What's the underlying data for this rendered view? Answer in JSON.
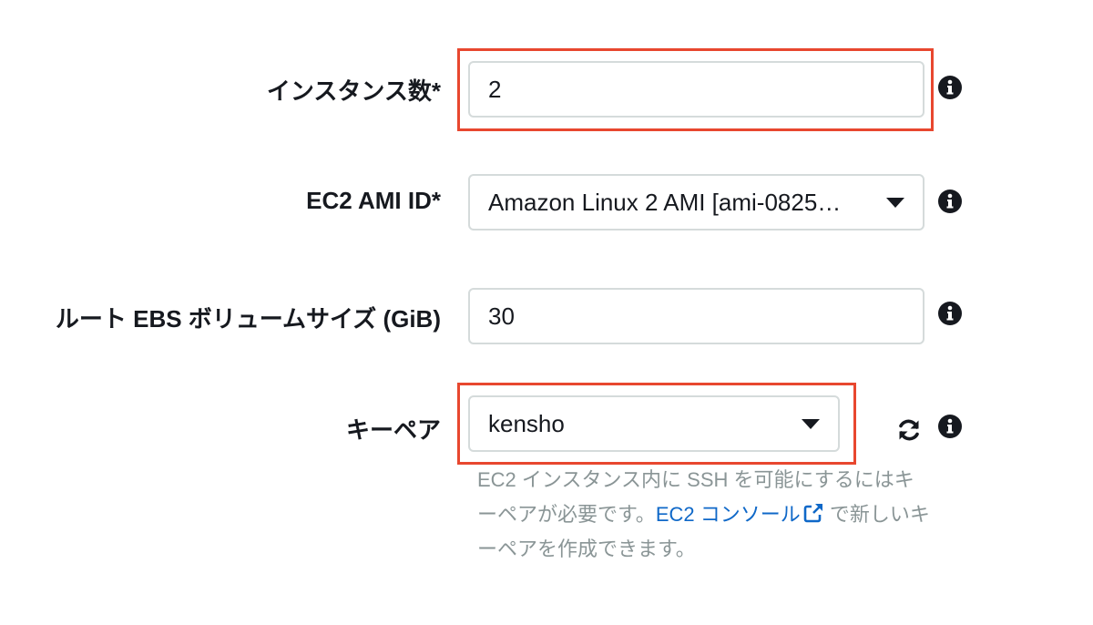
{
  "fields": {
    "instance_count": {
      "label": "インスタンス数*",
      "value": "2",
      "highlighted": true
    },
    "ami_id": {
      "label": "EC2 AMI ID*",
      "value": "Amazon Linux 2 AMI [ami-0825…",
      "icon": "chevron-down-icon"
    },
    "root_ebs_size": {
      "label": "ルート EBS ボリュームサイズ (GiB)",
      "value": "30"
    },
    "key_pair": {
      "label": "キーペア",
      "value": "kensho",
      "highlighted": true,
      "icon": "chevron-down-icon",
      "help": {
        "text_before": "EC2 インスタンス内に SSH を可能にするにはキーペアが必要です。",
        "link_text": "EC2 コンソール",
        "text_after": " で新しいキーペアを作成できます。"
      }
    }
  },
  "icons": {
    "info": "info-icon",
    "refresh": "refresh-icon",
    "external_link": "external-link-icon"
  },
  "colors": {
    "highlight": "#e8472f",
    "link": "#0f68c8",
    "help_text": "#8a9596",
    "input_border": "#d5dbdb"
  }
}
